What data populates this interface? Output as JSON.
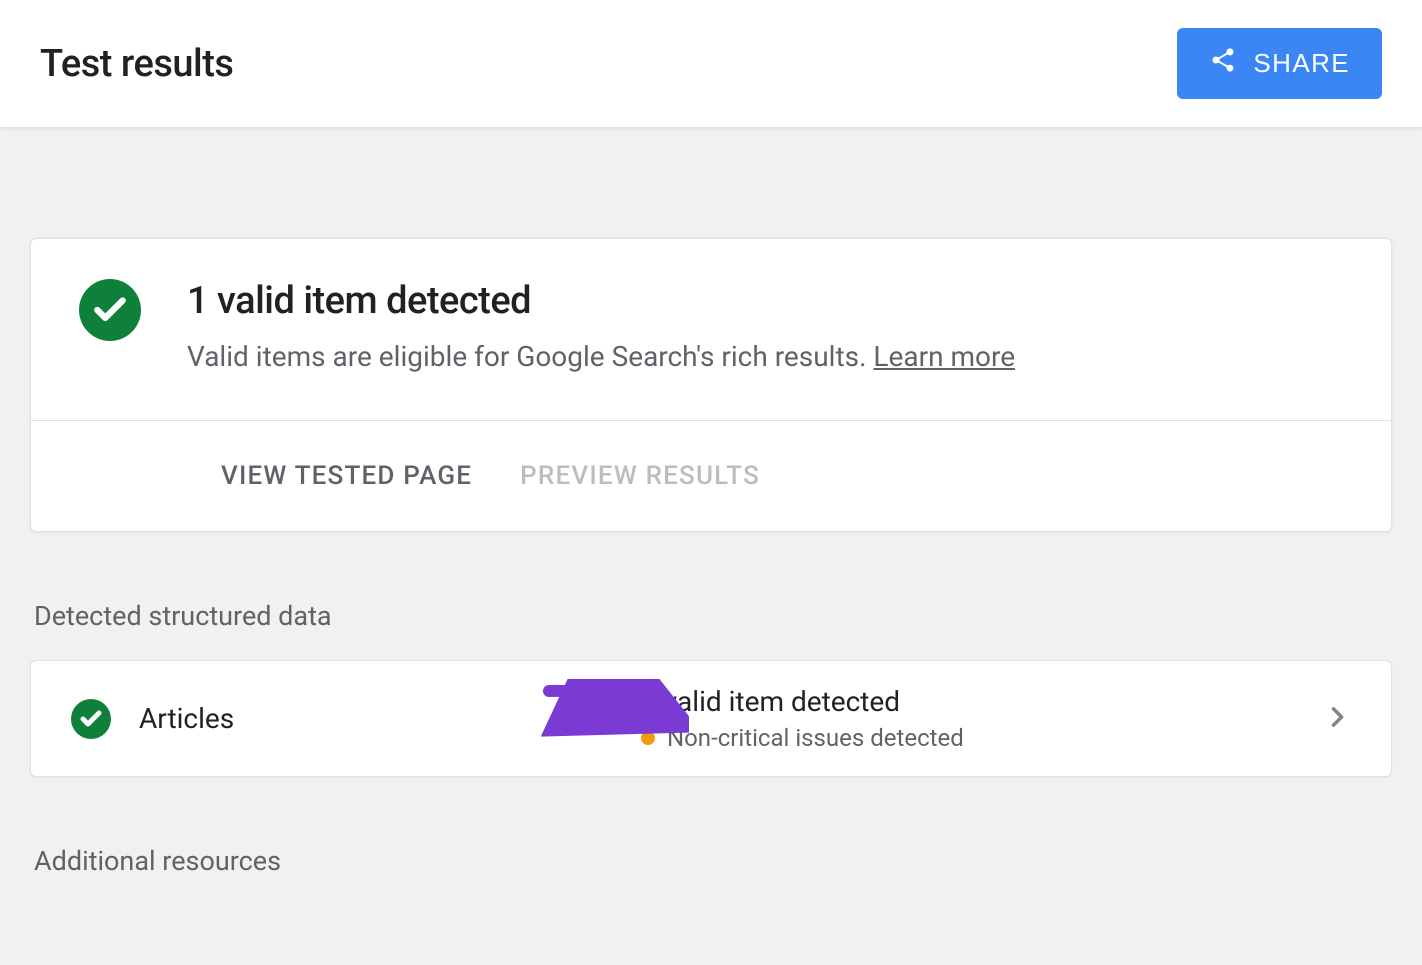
{
  "header": {
    "title": "Test results",
    "share_label": "SHARE"
  },
  "summary": {
    "heading": "1 valid item detected",
    "description": "Valid items are eligible for Google Search's rich results. ",
    "learn_more": "Learn more",
    "view_tested_page": "VIEW TESTED PAGE",
    "preview_results": "PREVIEW RESULTS"
  },
  "sections": {
    "detected_title": "Detected structured data",
    "additional_title": "Additional resources"
  },
  "detected": {
    "type": "Articles",
    "valid": "1 valid item detected",
    "issues": "Non-critical issues detected"
  },
  "colors": {
    "success": "#0f803a",
    "accent": "#3a86f5",
    "warning": "#f09b0f",
    "annotation": "#7b3ad4"
  }
}
